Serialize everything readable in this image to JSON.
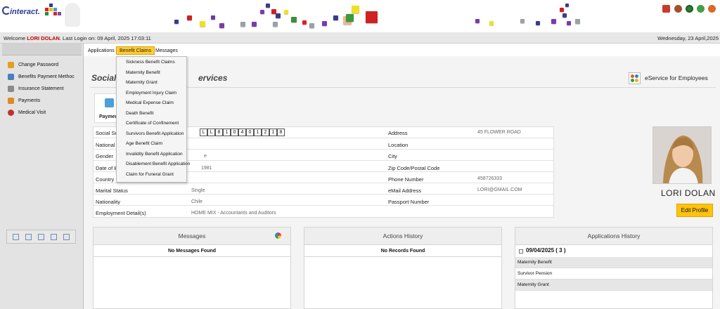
{
  "header": {
    "logo_text": "interact."
  },
  "welcome": {
    "prefix": "Welcome",
    "user_name": "LORI DOLAN",
    "last_login": ". Last Login on: 09 April, 2025 17:03:11",
    "date": "Wednesday, 23 April,2025"
  },
  "sidebar": {
    "items": [
      {
        "label": "Change Password",
        "icon": "key-icon"
      },
      {
        "label": "Benefits Payment Methoc",
        "icon": "payment-method-icon"
      },
      {
        "label": "Insurance Statement",
        "icon": "statement-icon"
      },
      {
        "label": "Payments",
        "icon": "payments-icon"
      },
      {
        "label": "Medical Visit",
        "icon": "medical-icon"
      }
    ]
  },
  "nav": {
    "tabs": [
      "Applications",
      "Benefit Claims",
      "Messages"
    ],
    "active": "Benefit Claims"
  },
  "dropdown": {
    "items": [
      "Sickness Benefit Claims",
      "Maternity Benefit",
      "Maternity Grant",
      "Employment Injury Claim",
      "Medical Expense Claim",
      "Death Benefit",
      "Certificate of Confinement",
      "Survivors Benefit Application",
      "Age Benefit Claim",
      "Invalidity Benefit Application",
      "Disablement Benefit Application",
      "Claim for Funeral Grant"
    ]
  },
  "main": {
    "title_left": "Social S",
    "title_right": "ervices",
    "eservice_label": "eService for Employees",
    "tile_label": "Paymen"
  },
  "info": {
    "ssn_label": "Social Se",
    "ssn_chars": [
      "L",
      "L",
      "8",
      "1",
      "0",
      "4",
      "0",
      "1",
      "2",
      "1",
      "8"
    ],
    "national_label": "National",
    "gender_label": "Gender",
    "gender_value": "e",
    "dob_label": "Date of B",
    "dob_value": "1981",
    "country_label": "Country",
    "marital_label": "Marital Status",
    "marital_value": "Single",
    "nationality_label": "Nationality",
    "nationality_value": "Chile",
    "employment_label": "Employment Detail(s)",
    "employment_value": "HOME MIX - Accountants and Auditors",
    "address_label": "Address",
    "address_value": "45 FLOWER ROAD",
    "location_label": "Location",
    "city_label": "City",
    "zip_label": "Zip Code/Postal Code",
    "phone_label": "Phone Number",
    "phone_value": "458726333",
    "email_label": "eMail Address",
    "email_value": "LORI@GMAIL.COM",
    "passport_label": "Passport Number"
  },
  "profile": {
    "name": "LORI DOLAN",
    "edit_label": "Edit Profile"
  },
  "panels": {
    "messages_title": "Messages",
    "messages_empty": "No Messages Found",
    "actions_title": "Actions History",
    "actions_empty": "No Records Found",
    "apps_title": "Applications History",
    "apps_group": "09/04/2025 ( 3 )",
    "apps_rows": [
      "Maternity Benefit",
      "Survivor Pension",
      "Maternity Grant"
    ]
  },
  "colors": {
    "accent_yellow": "#ffcc33",
    "welcome_name": "#c00000",
    "logo_blue": "#2a3d8f"
  }
}
